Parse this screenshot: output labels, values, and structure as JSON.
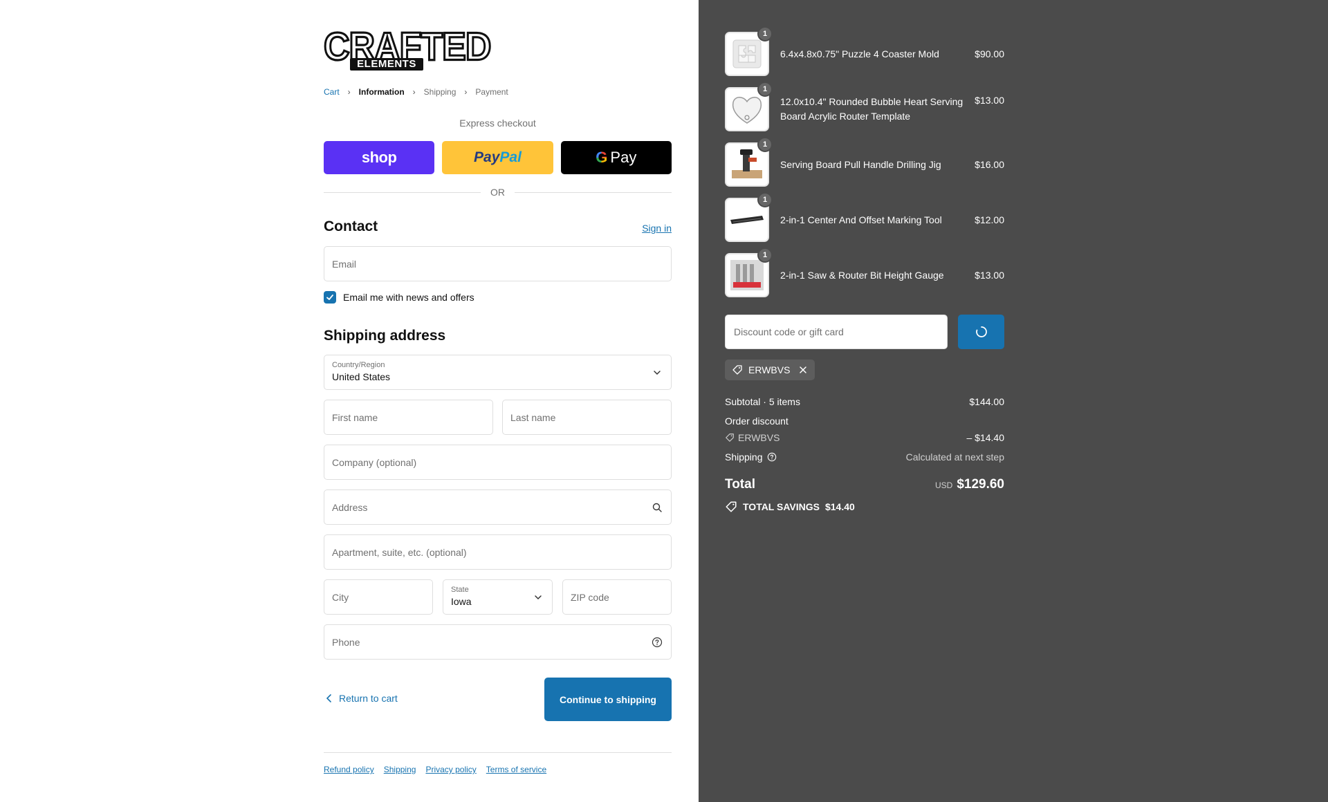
{
  "brand": {
    "logo_top": "CRAFTED",
    "logo_bottom": "ELEMENTS"
  },
  "breadcrumb": {
    "cart": "Cart",
    "information": "Information",
    "shipping": "Shipping",
    "payment": "Payment"
  },
  "express": {
    "label": "Express checkout",
    "shop_label": "shop",
    "paypal_label_a": "Pay",
    "paypal_label_b": "Pal",
    "gpay_g": "G",
    "gpay_label": "Pay",
    "or_label": "OR"
  },
  "contact": {
    "title": "Contact",
    "sign_in": "Sign in",
    "email_placeholder": "Email",
    "news_label": "Email me with news and offers",
    "news_checked": true
  },
  "shipping_address": {
    "title": "Shipping address",
    "country_label": "Country/Region",
    "country_value": "United States",
    "first_name_placeholder": "First name",
    "last_name_placeholder": "Last name",
    "company_placeholder": "Company (optional)",
    "address_placeholder": "Address",
    "apartment_placeholder": "Apartment, suite, etc. (optional)",
    "city_placeholder": "City",
    "state_label": "State",
    "state_value": "Iowa",
    "zip_placeholder": "ZIP code",
    "phone_placeholder": "Phone"
  },
  "actions": {
    "return_label": "Return to cart",
    "continue_label": "Continue to shipping"
  },
  "footer": {
    "refund": "Refund policy",
    "shipping": "Shipping",
    "privacy": "Privacy policy",
    "terms": "Terms of service"
  },
  "cart": {
    "items": [
      {
        "name": "6.4x4.8x0.75\" Puzzle 4 Coaster Mold",
        "price": "$90.00",
        "qty": "1"
      },
      {
        "name": "12.0x10.4\" Rounded Bubble Heart Serving Board Acrylic Router Template",
        "price": "$13.00",
        "qty": "1"
      },
      {
        "name": "Serving Board Pull Handle Drilling Jig",
        "price": "$16.00",
        "qty": "1"
      },
      {
        "name": "2-in-1 Center And Offset Marking Tool",
        "price": "$12.00",
        "qty": "1"
      },
      {
        "name": "2-in-1 Saw & Router Bit Height Gauge",
        "price": "$13.00",
        "qty": "1"
      }
    ],
    "discount_placeholder": "Discount code or gift card",
    "applied_code": "ERWBVS",
    "subtotal_label": "Subtotal · 5 items",
    "subtotal_value": "$144.00",
    "order_discount_label": "Order discount",
    "discount_code": "ERWBVS",
    "discount_value": "– $14.40",
    "shipping_label": "Shipping",
    "shipping_value": "Calculated at next step",
    "total_label": "Total",
    "currency": "USD",
    "total_value": "$129.60",
    "savings_label": "TOTAL SAVINGS",
    "savings_value": "$14.40"
  },
  "colors": {
    "accent": "#1773b0",
    "summary_bg": "#4b4b4b",
    "shop_pay": "#5a31f4",
    "paypal": "#ffc439"
  }
}
